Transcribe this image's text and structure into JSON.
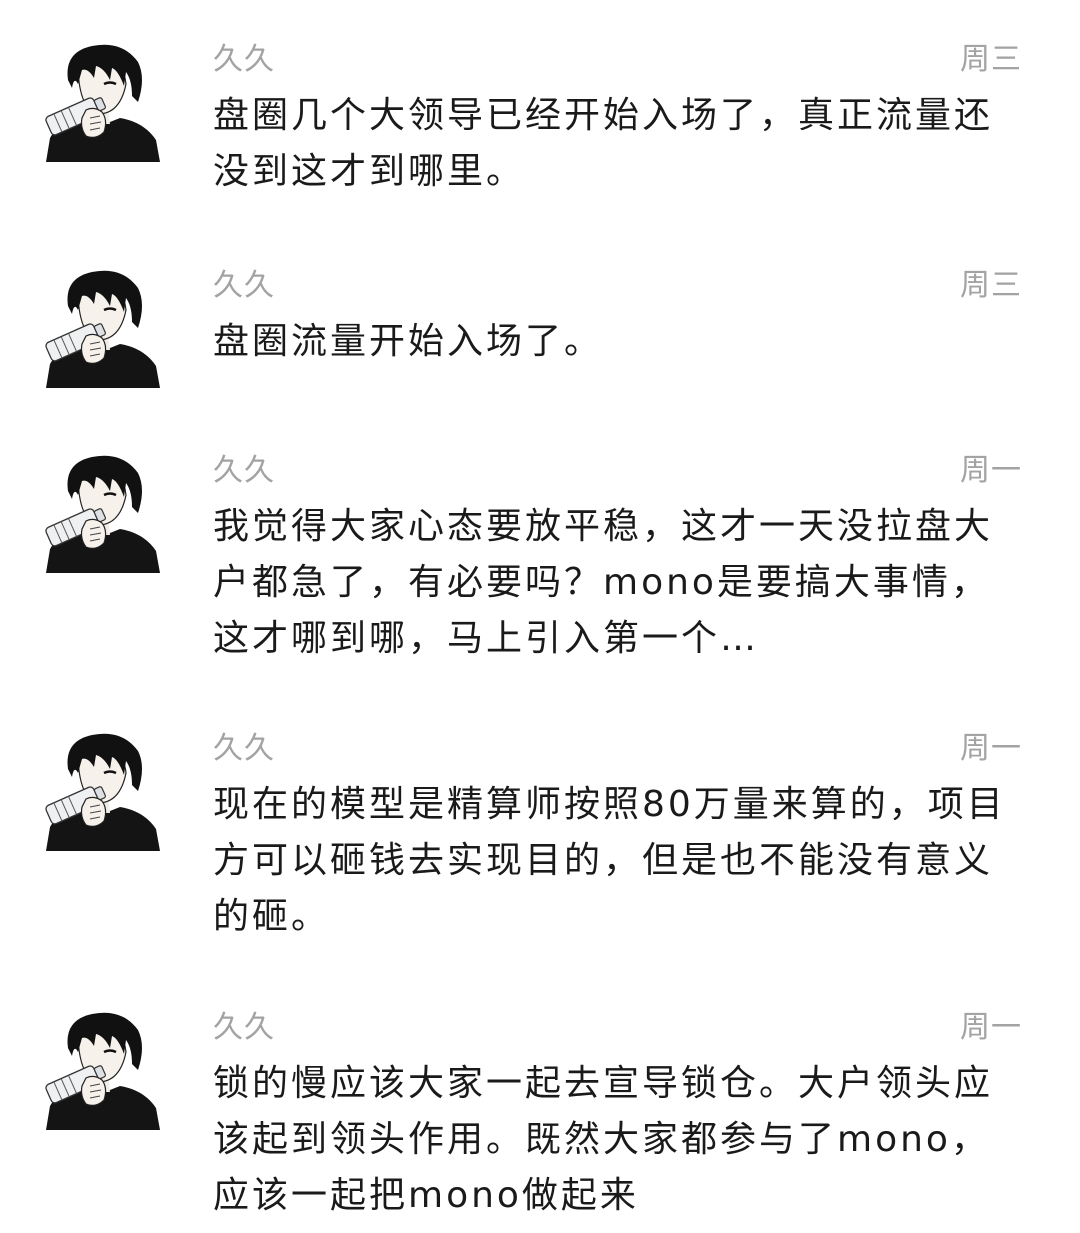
{
  "conversations": [
    {
      "sender": "久久",
      "day": "周三",
      "text": "盘圈几个大领导已经开始入场了，真正流量还没到这才到哪里。",
      "avatar_icon": "anime-boy-drinking-avatar"
    },
    {
      "sender": "久久",
      "day": "周三",
      "text": "盘圈流量开始入场了。",
      "avatar_icon": "anime-boy-drinking-avatar"
    },
    {
      "sender": "久久",
      "day": "周一",
      "text": "我觉得大家心态要放平稳，这才一天没拉盘大户都急了，有必要吗？mono是要搞大事情，这才哪到哪，马上引入第一个…",
      "avatar_icon": "anime-boy-drinking-avatar"
    },
    {
      "sender": "久久",
      "day": "周一",
      "text": "现在的模型是精算师按照80万量来算的，项目方可以砸钱去实现目的，但是也不能没有意义的砸。",
      "avatar_icon": "anime-boy-drinking-avatar"
    },
    {
      "sender": "久久",
      "day": "周一",
      "text": "锁的慢应该大家一起去宣导锁仓。大户领头应该起到领头作用。既然大家都参与了mono，应该一起把mono做起来",
      "avatar_icon": "anime-boy-drinking-avatar"
    }
  ],
  "colors": {
    "meta_text": "#a3a3a3",
    "body_text": "#1a1a1a",
    "background": "#ffffff"
  }
}
